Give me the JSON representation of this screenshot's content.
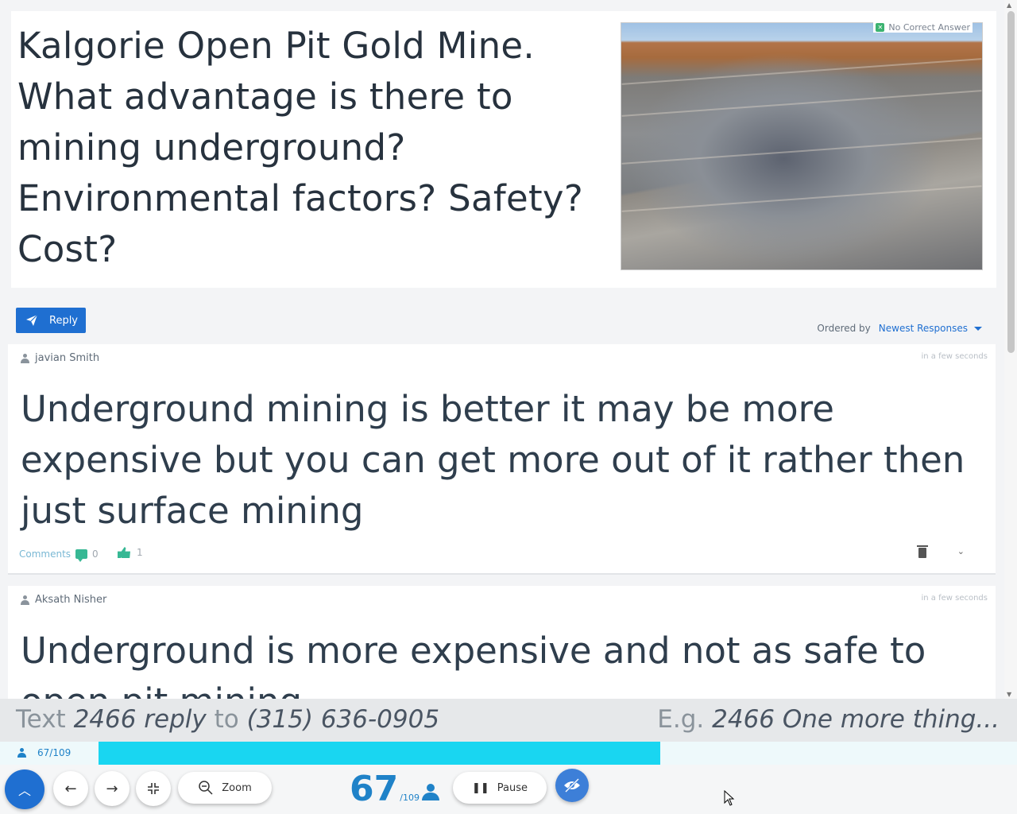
{
  "question": {
    "text": "Kalgorie Open Pit Gold Mine.  What advantage is there to mining underground?  Environmental factors? Safety? Cost?",
    "badge": "No Correct Answer"
  },
  "actions": {
    "reply_label": "Reply",
    "ordered_by_label": "Ordered by",
    "order_value": "Newest Responses"
  },
  "responses": [
    {
      "author": "javian Smith",
      "time": "in a few seconds",
      "text": "Underground mining is better it may be more expensive but you can get more out of it rather then just surface mining",
      "comments_label": "Comments",
      "comment_count": "0",
      "like_count": "1"
    },
    {
      "author": "Aksath Nisher",
      "time": "in a few seconds",
      "text": "Underground is more expensive and not as safe to open pit mining"
    }
  ],
  "instructions": {
    "left_prefix": "Text",
    "left_code": "2466 reply",
    "left_mid": "to",
    "left_number": "(315) 636-0905",
    "right_prefix": "E.g.",
    "right_example": "2466 One more thing..."
  },
  "progress": {
    "label": "67/109",
    "fraction": 0.612
  },
  "toolbar": {
    "zoom_label": "Zoom",
    "pause_label": "Pause",
    "count_current": "67",
    "count_total": "/109"
  },
  "colors": {
    "accent": "#1f6fd1",
    "progress": "#19d6f1",
    "like": "#37b894"
  }
}
